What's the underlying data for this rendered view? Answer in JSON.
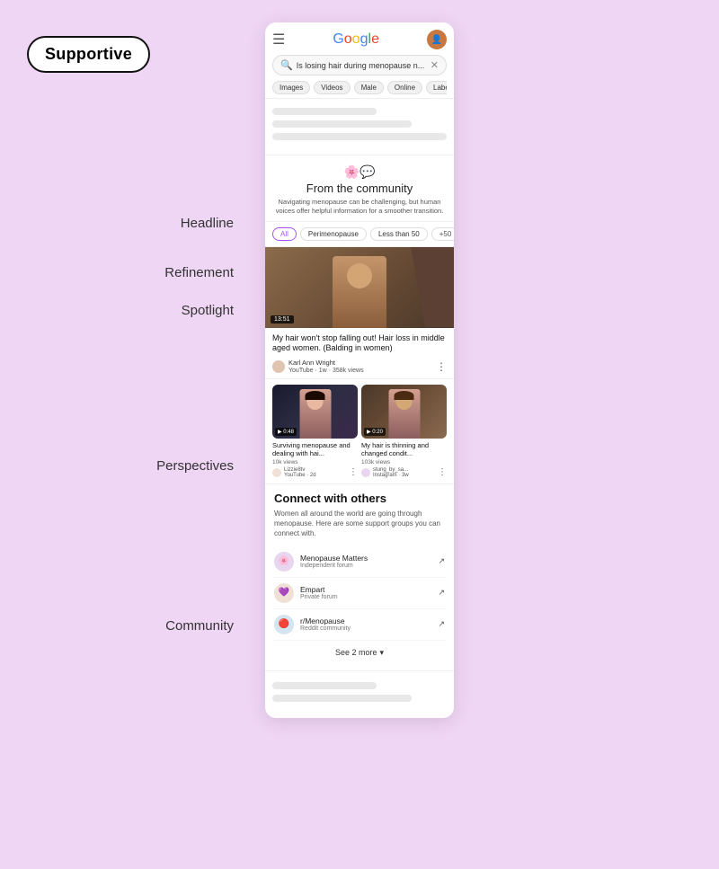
{
  "app": {
    "logo": "Supportive"
  },
  "labels": {
    "headline": "Headline",
    "refinement": "Refinement",
    "spotlight": "Spotlight",
    "perspectives": "Perspectives",
    "community": "Community"
  },
  "google": {
    "search_query": "Is losing hair during menopause n...",
    "filters": [
      "Images",
      "Videos",
      "Male",
      "Online",
      "Label"
    ]
  },
  "from_community": {
    "emoji": "🌸💬",
    "title": "From the community",
    "description": "Navigating menopause can be challenging, but human voices offer helpful information for a smoother transition."
  },
  "refinement_pills": [
    {
      "label": "All",
      "active": true
    },
    {
      "label": "Perimenopause",
      "active": false
    },
    {
      "label": "Less than 50",
      "active": false
    },
    {
      "label": "+50",
      "active": false
    }
  ],
  "spotlight_video": {
    "duration": "13:51",
    "title": "My hair won't stop falling out! Hair loss in middle aged women. (Balding in women)",
    "channel_name": "Karl Ann Wright",
    "platform": "YouTube",
    "time_ago": "1w",
    "views": "358k views"
  },
  "perspectives_videos": [
    {
      "duration": "0:48",
      "title": "Surviving menopause and dealing with hai...",
      "views": "10k views",
      "channel": "Lizzie8tv",
      "platform": "YouTube",
      "time_ago": "2d",
      "bg_color_class": "small-thumb-1"
    },
    {
      "duration": "0:20",
      "title": "My hair is thinning and changed condit...",
      "views": "103k views",
      "channel": "stung_by_sa...",
      "platform": "Instagram",
      "time_ago": "3w",
      "bg_color_class": "small-thumb-2"
    }
  ],
  "connect_section": {
    "title": "Connect with others",
    "description": "Women all around the world are going through menopause. Here are some support groups you can connect with.",
    "forums": [
      {
        "name": "Menopause Matters",
        "type": "Independent forum",
        "icon_emoji": "🌸",
        "icon_class": "forum-icon-1"
      },
      {
        "name": "Empart",
        "type": "Private forum",
        "icon_emoji": "💜",
        "icon_class": "forum-icon-2"
      },
      {
        "name": "r/Menopause",
        "type": "Reddit community",
        "icon_emoji": "🔴",
        "icon_class": "forum-icon-3"
      }
    ],
    "see_more": "See 2 more"
  }
}
